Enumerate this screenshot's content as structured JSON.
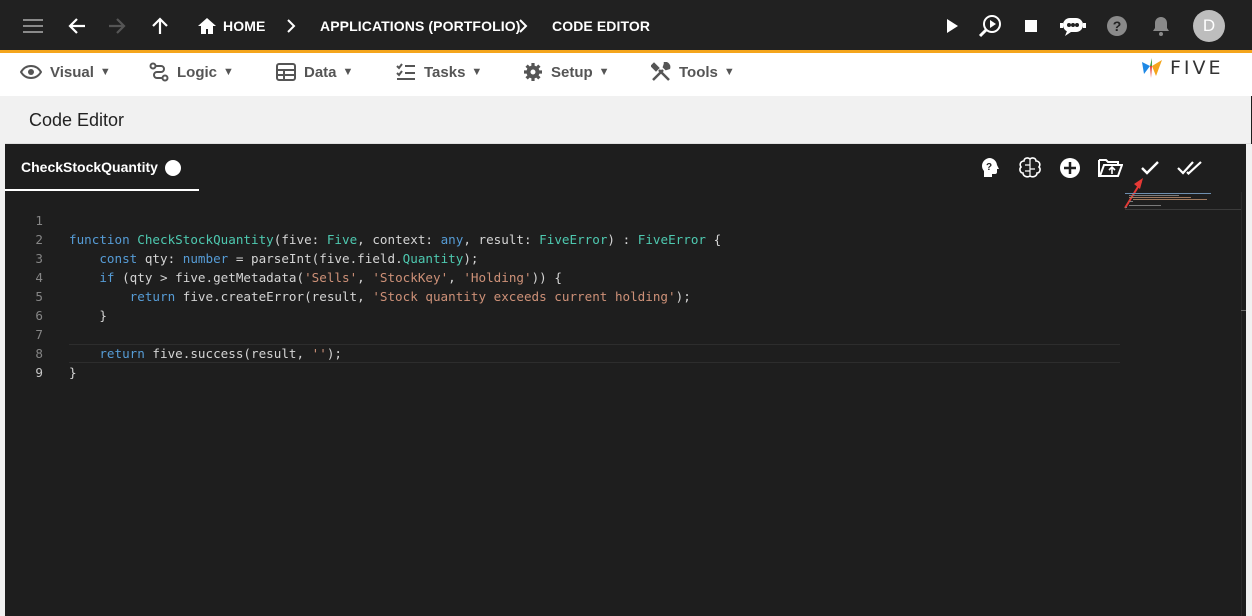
{
  "breadcrumb": {
    "home": "HOME",
    "applications": "APPLICATIONS (PORTFOLIO)",
    "current": "CODE EDITOR"
  },
  "user": {
    "avatar_initial": "D"
  },
  "menu": {
    "items": [
      {
        "label": "Visual",
        "icon": "eye-icon"
      },
      {
        "label": "Logic",
        "icon": "logic-icon"
      },
      {
        "label": "Data",
        "icon": "table-icon"
      },
      {
        "label": "Tasks",
        "icon": "tasks-icon"
      },
      {
        "label": "Setup",
        "icon": "gear-icon"
      },
      {
        "label": "Tools",
        "icon": "tools-icon"
      }
    ],
    "caret": "▼"
  },
  "brand": {
    "name": "FIVE"
  },
  "page": {
    "title": "Code Editor"
  },
  "editor": {
    "tab_label": "CheckStockQuantity",
    "line_numbers": [
      "1",
      "2",
      "3",
      "4",
      "5",
      "6",
      "7",
      "8",
      "9"
    ],
    "lines": [
      "function CheckStockQuantity(five: Five, context: any, result: FiveError) : FiveError {",
      "    const qty: number = parseInt(five.field.Quantity);",
      "    if (qty > five.getMetadata('Sells', 'StockKey', 'Holding')) {",
      "        return five.createError(result, 'Stock quantity exceeds current holding');",
      "    }",
      "",
      "    return five.success(result, '');",
      "}",
      ""
    ]
  },
  "colors": {
    "accent": "#f4a51c",
    "keyword": "#569cd6",
    "type": "#4ec9b0",
    "string": "#ce9178",
    "text": "#d4d4d4"
  }
}
